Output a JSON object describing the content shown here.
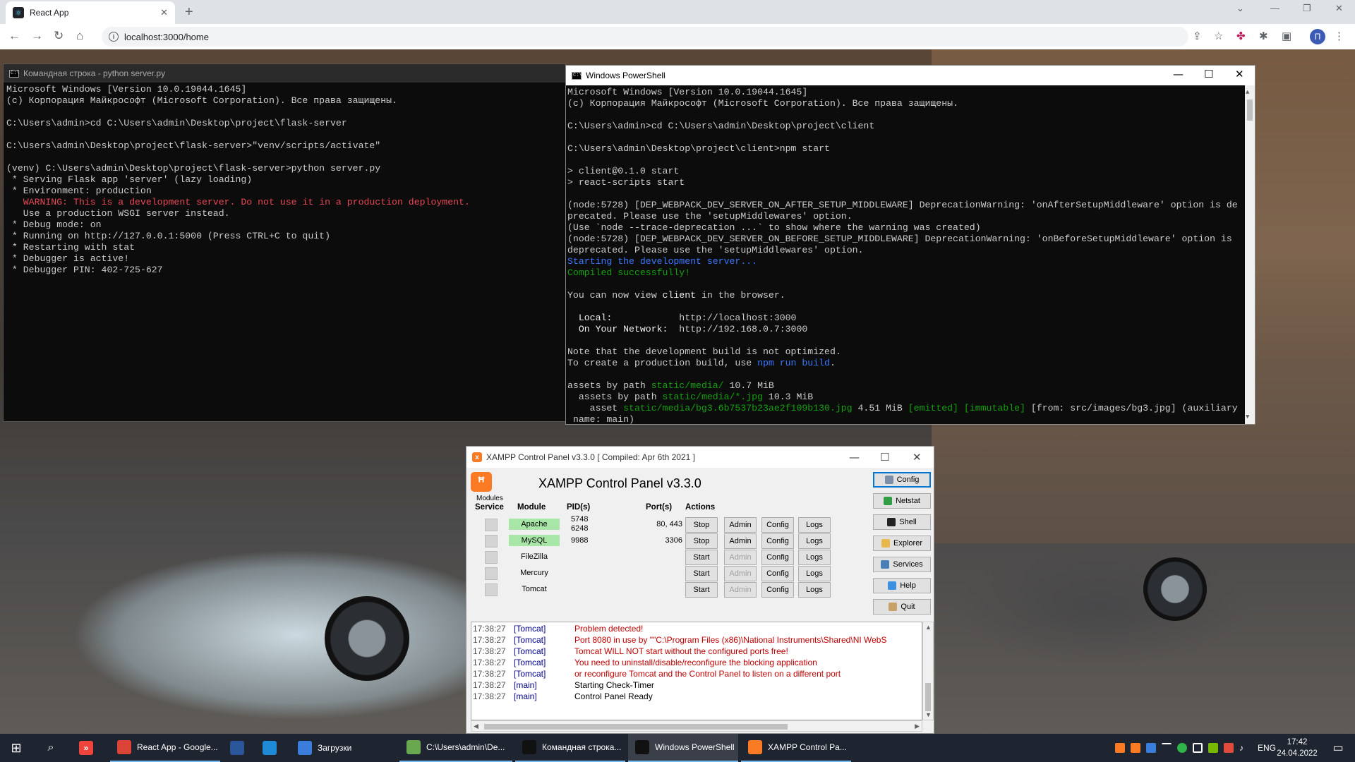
{
  "browser": {
    "tab_title": "React App",
    "url": "localhost:3000/home"
  },
  "cmd": {
    "title": "Командная строка - python  server.py",
    "lines": [
      "Microsoft Windows [Version 10.0.19044.1645]",
      "(c) Корпорация Майкрософт (Microsoft Corporation). Все права защищены.",
      "",
      "C:\\Users\\admin>cd C:\\Users\\admin\\Desktop\\project\\flask-server",
      "",
      "C:\\Users\\admin\\Desktop\\project\\flask-server>\"venv/scripts/activate\"",
      "",
      "(venv) C:\\Users\\admin\\Desktop\\project\\flask-server>python server.py",
      " * Serving Flask app 'server' (lazy loading)",
      " * Environment: production",
      "   WARNING: This is a development server. Do not use it in a production deployment.",
      "   Use a production WSGI server instead.",
      " * Debug mode: on",
      " * Running on http://127.0.0.1:5000 (Press CTRL+C to quit)",
      " * Restarting with stat",
      " * Debugger is active!",
      " * Debugger PIN: 402-725-627"
    ],
    "warning_line_index": 10
  },
  "powershell": {
    "title": "Windows PowerShell",
    "lines": [
      [
        {
          "t": "Microsoft Windows [Version 10.0.19044.1645]"
        }
      ],
      [
        {
          "t": "(c) Корпорация Майкрософт (Microsoft Corporation). Все права защищены."
        }
      ],
      [
        {
          "t": ""
        }
      ],
      [
        {
          "t": "C:\\Users\\admin>cd C:\\Users\\admin\\Desktop\\project\\client"
        }
      ],
      [
        {
          "t": ""
        }
      ],
      [
        {
          "t": "C:\\Users\\admin\\Desktop\\project\\client>npm start"
        }
      ],
      [
        {
          "t": ""
        }
      ],
      [
        {
          "t": "> client@0.1.0 start"
        }
      ],
      [
        {
          "t": "> react-scripts start"
        }
      ],
      [
        {
          "t": ""
        }
      ],
      [
        {
          "t": "(node:5728) [DEP_WEBPACK_DEV_SERVER_ON_AFTER_SETUP_MIDDLEWARE] DeprecationWarning: 'onAfterSetupMiddleware' option is de"
        }
      ],
      [
        {
          "t": "precated. Please use the 'setupMiddlewares' option."
        }
      ],
      [
        {
          "t": "(Use `node --trace-deprecation ...` to show where the warning was created)"
        }
      ],
      [
        {
          "t": "(node:5728) [DEP_WEBPACK_DEV_SERVER_ON_BEFORE_SETUP_MIDDLEWARE] DeprecationWarning: 'onBeforeSetupMiddleware' option is"
        }
      ],
      [
        {
          "t": "deprecated. Please use the 'setupMiddlewares' option."
        }
      ],
      [
        {
          "t": "Starting the development server...",
          "c": "blue"
        }
      ],
      [
        {
          "t": "Compiled successfully!",
          "c": "green"
        }
      ],
      [
        {
          "t": ""
        }
      ],
      [
        {
          "t": "You can now view "
        },
        {
          "t": "client",
          "c": "white"
        },
        {
          "t": " in the browser."
        }
      ],
      [
        {
          "t": ""
        }
      ],
      [
        {
          "t": "  Local:            ",
          "c": "white"
        },
        {
          "t": "http://localhost:3000"
        }
      ],
      [
        {
          "t": "  On Your Network:  ",
          "c": "white"
        },
        {
          "t": "http://192.168.0.7:3000"
        }
      ],
      [
        {
          "t": ""
        }
      ],
      [
        {
          "t": "Note that the development build is not optimized."
        }
      ],
      [
        {
          "t": "To create a production build, use "
        },
        {
          "t": "npm run build",
          "c": "blue"
        },
        {
          "t": "."
        }
      ],
      [
        {
          "t": ""
        }
      ],
      [
        {
          "t": "assets by path "
        },
        {
          "t": "static/media/",
          "c": "green"
        },
        {
          "t": " 10.7 MiB"
        }
      ],
      [
        {
          "t": "  assets by path "
        },
        {
          "t": "static/media/*.jpg",
          "c": "green"
        },
        {
          "t": " 10.3 MiB"
        }
      ],
      [
        {
          "t": "    asset "
        },
        {
          "t": "static/media/bg3.6b7537b23ae2f109b130.jpg",
          "c": "green"
        },
        {
          "t": " 4.51 MiB "
        },
        {
          "t": "[emitted] [immutable]",
          "c": "green"
        },
        {
          "t": " [from: src/images/bg3.jpg] (auxiliary"
        }
      ],
      [
        {
          "t": " name: main)"
        }
      ]
    ]
  },
  "xampp": {
    "title": "XAMPP Control Panel v3.3.0   [ Compiled: Apr 6th 2021 ]",
    "heading": "XAMPP Control Panel v3.3.0",
    "modules_label": "Modules",
    "columns": {
      "service": "Service",
      "module": "Module",
      "pid": "PID(s)",
      "port": "Port(s)",
      "actions": "Actions"
    },
    "rows": [
      {
        "module": "Apache",
        "running": true,
        "pid1": "5748",
        "pid2": "6248",
        "port": "80, 443",
        "action": "Stop"
      },
      {
        "module": "MySQL",
        "running": true,
        "pid1": "9988",
        "pid2": "",
        "port": "3306",
        "action": "Stop"
      },
      {
        "module": "FileZilla",
        "running": false,
        "pid1": "",
        "pid2": "",
        "port": "",
        "action": "Start"
      },
      {
        "module": "Mercury",
        "running": false,
        "pid1": "",
        "pid2": "",
        "port": "",
        "action": "Start"
      },
      {
        "module": "Tomcat",
        "running": false,
        "pid1": "",
        "pid2": "",
        "port": "",
        "action": "Start"
      }
    ],
    "btn_admin": "Admin",
    "btn_config": "Config",
    "btn_logs": "Logs",
    "side": [
      {
        "label": "Config",
        "icon": "wrench-icon",
        "color": "#7a8fa6"
      },
      {
        "label": "Netstat",
        "icon": "globe-icon",
        "color": "#2f9e44"
      },
      {
        "label": "Shell",
        "icon": "terminal-icon",
        "color": "#222222"
      },
      {
        "label": "Explorer",
        "icon": "folder-icon",
        "color": "#e8b84a"
      },
      {
        "label": "Services",
        "icon": "services-icon",
        "color": "#4a7fb5"
      },
      {
        "label": "Help",
        "icon": "help-icon",
        "color": "#3d8fe0"
      },
      {
        "label": "Quit",
        "icon": "quit-icon",
        "color": "#c8a06a"
      }
    ],
    "log": [
      {
        "time": "17:38:27",
        "src": "[Tomcat]",
        "msg": "Problem detected!",
        "err": true
      },
      {
        "time": "17:38:27",
        "src": "[Tomcat]",
        "msg": "Port 8080 in use by \"\"C:\\Program Files (x86)\\National Instruments\\Shared\\NI WebS",
        "err": true
      },
      {
        "time": "17:38:27",
        "src": "[Tomcat]",
        "msg": "Tomcat WILL NOT start without the configured ports free!",
        "err": true
      },
      {
        "time": "17:38:27",
        "src": "[Tomcat]",
        "msg": "You need to uninstall/disable/reconfigure the blocking application",
        "err": true
      },
      {
        "time": "17:38:27",
        "src": "[Tomcat]",
        "msg": "or reconfigure Tomcat and the Control Panel to listen on a different port",
        "err": true
      },
      {
        "time": "17:38:27",
        "src": "[main]",
        "msg": "Starting Check-Timer",
        "err": false
      },
      {
        "time": "17:38:27",
        "src": "[main]",
        "msg": "Control Panel Ready",
        "err": false
      }
    ]
  },
  "taskbar": {
    "items": [
      {
        "label": "React App - Google...",
        "icon": "chrome-icon",
        "color": "#db4437",
        "state": "open"
      },
      {
        "label": "",
        "icon": "word-icon",
        "color": "#2b579a",
        "state": "none"
      },
      {
        "label": "",
        "icon": "edge-icon",
        "color": "#1f8ad6",
        "state": "none"
      },
      {
        "label": "Загрузки",
        "icon": "download-icon",
        "color": "#3b7ddd",
        "state": "none"
      },
      {
        "label": "C:\\Users\\admin\\De...",
        "icon": "notepad-icon",
        "color": "#6aa84f",
        "state": "open"
      },
      {
        "label": "Командная строка...",
        "icon": "cmd-icon",
        "color": "#111111",
        "state": "open"
      },
      {
        "label": "Windows PowerShell",
        "icon": "powershell-icon",
        "color": "#111111",
        "state": "active"
      },
      {
        "label": "XAMPP Control Pa...",
        "icon": "xampp-icon",
        "color": "#fb7a24",
        "state": "open"
      }
    ],
    "language": "ENG",
    "time": "17:42",
    "date": "24.04.2022"
  },
  "colors": {
    "console_red": "#e74856",
    "console_blue": "#3b78ff",
    "console_green": "#13a10e",
    "xampp_running": "#a8e6a8",
    "xampp_orange": "#fb7a24"
  }
}
